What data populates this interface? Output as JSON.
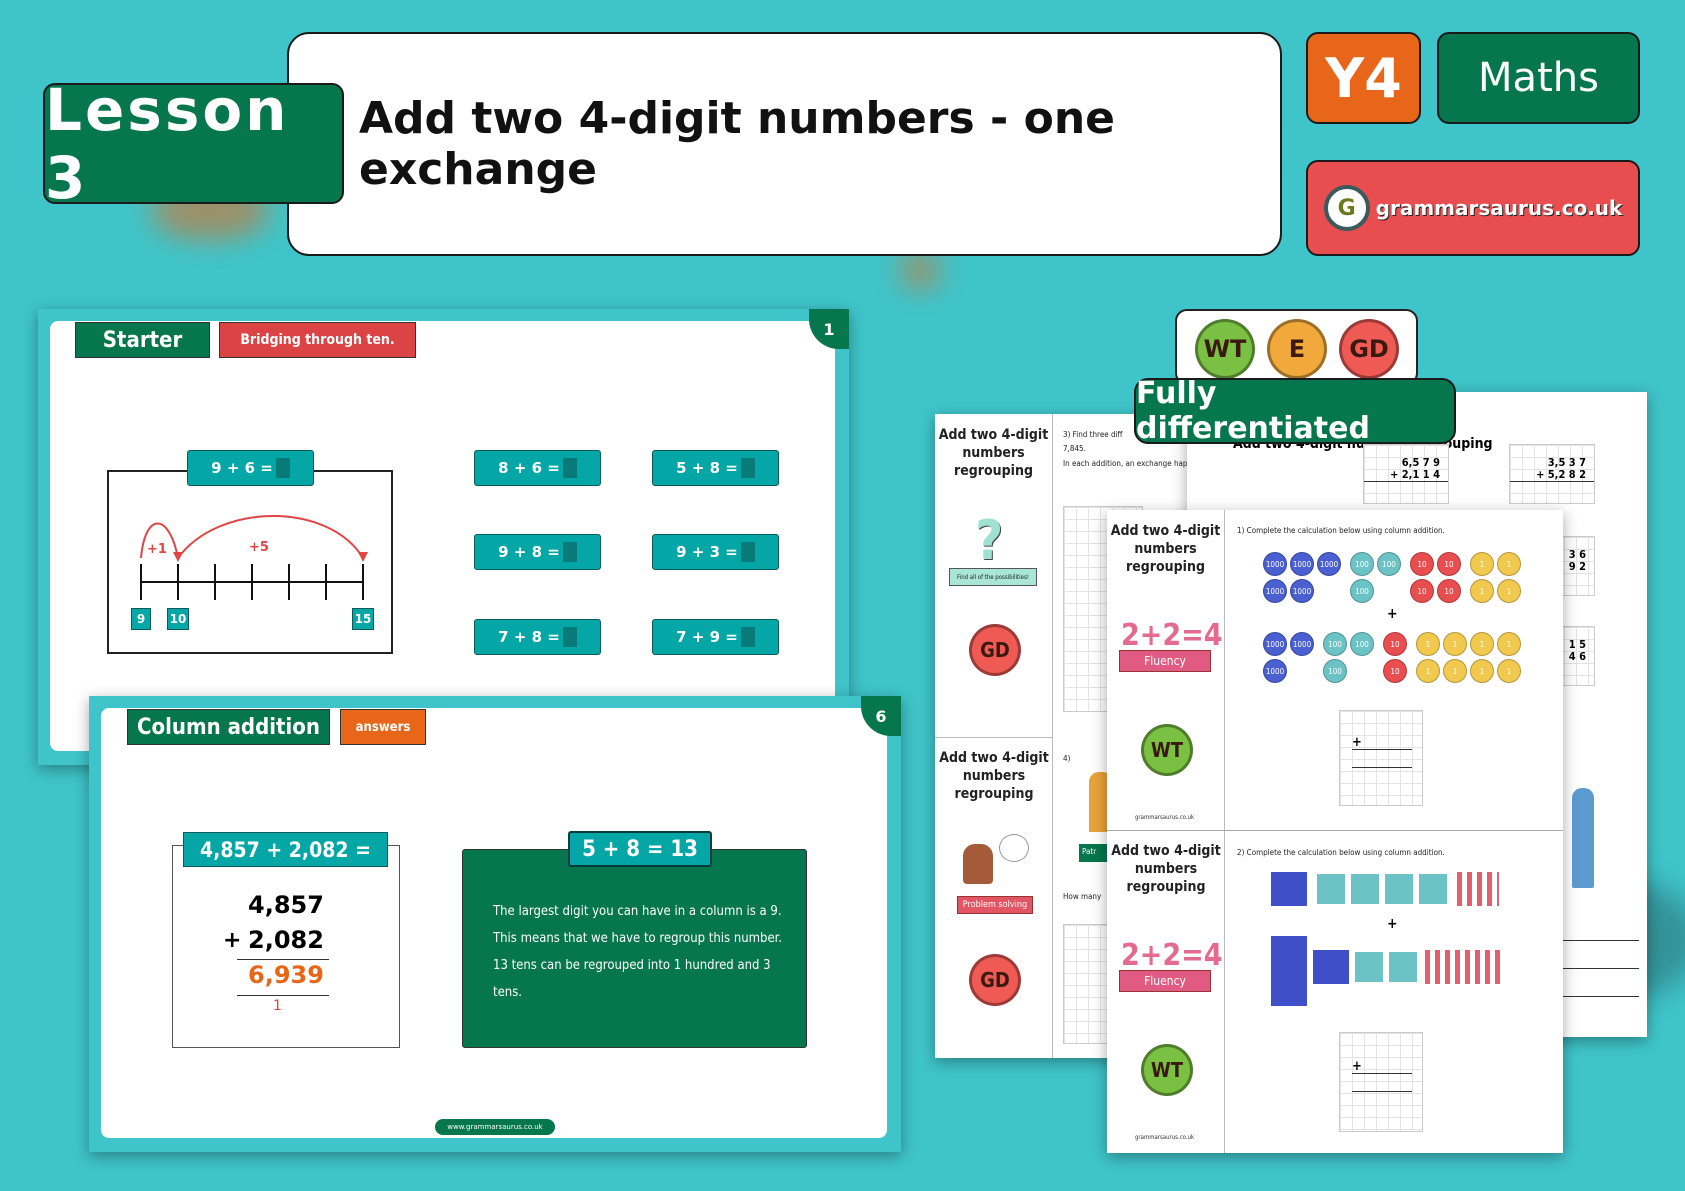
{
  "header": {
    "lesson": "Lesson 3",
    "title": "Add two 4-digit numbers - one exchange",
    "year": "Y4",
    "subject": "Maths",
    "brand": "grammarsaurus.co.uk"
  },
  "colors": {
    "background": "#3fc4c9",
    "green": "#05764d",
    "orange": "#e8661a",
    "red": "#e84d50",
    "teal": "#04a6a6"
  },
  "starter_slide": {
    "page_number": "1",
    "title": "Starter",
    "subtitle": "Bridging through ten.",
    "example": "9 + 6 =",
    "number_line": {
      "jumps": [
        "+1",
        "+5"
      ],
      "labels": [
        "9",
        "10",
        "15"
      ]
    },
    "questions": [
      "8 + 6 =",
      "5 + 8 =",
      "9 + 8 =",
      "9 + 3 =",
      "7 + 8 =",
      "7 + 9 ="
    ]
  },
  "column_slide": {
    "page_number": "6",
    "title": "Column addition",
    "tag": "answers",
    "question": "4,857 + 2,082 =",
    "addend1": "4,857",
    "plus": "+",
    "addend2": "2,082",
    "answer": "6,939",
    "carry": "1",
    "explanation_title": "5 + 8 = 13",
    "explanation": "The largest digit you can have in a column is a 9. This means that we have to regroup this number. 13 tens can be regrouped into 1 hundred and 3 tens.",
    "footer": "www.grammarsaurus.co.uk"
  },
  "differentiation": {
    "badges": [
      "WT",
      "E",
      "GD"
    ],
    "label": "Fully differentiated"
  },
  "worksheets": {
    "title": "Add two 4-digit numbers regrouping",
    "left": {
      "q3": "3) Find three diff",
      "q3_line2": "7,845.",
      "q3_line3": "In each addition, an exchange hap",
      "q4": "4)",
      "q4_text": "How many",
      "possibilities": "Find all of the possibilities!",
      "problem_solving": "Problem solving",
      "badge": "GD",
      "name_tag": "Patr"
    },
    "back_right": {
      "sum1": [
        "6,5 7 9",
        "+ 2,1 1 4"
      ],
      "sum2": [
        "3,5 3 7",
        "+ 5,2 8 2"
      ],
      "partial1": [
        "3 6",
        "9 2"
      ],
      "partial2": [
        "1 5",
        "4 6"
      ]
    },
    "front": {
      "q1": "1) Complete the calculation below using column addition.",
      "q2": "2) Complete the calculation below using column addition.",
      "fluency": "Fluency",
      "fluency_art": "2+2=4",
      "badge": "WT",
      "plus": "+",
      "coins_top": [
        "1000",
        "1000",
        "1000",
        "1000",
        "1000",
        "100",
        "100",
        "100",
        "10",
        "10",
        "10",
        "10",
        "1",
        "1",
        "1",
        "1"
      ],
      "coins_bottom": [
        "1000",
        "1000",
        "1000",
        "100",
        "100",
        "100",
        "10",
        "10",
        "1",
        "1",
        "1",
        "1",
        "1",
        "1",
        "1",
        "1"
      ]
    },
    "footer": "grammarsaurus.co.uk"
  }
}
